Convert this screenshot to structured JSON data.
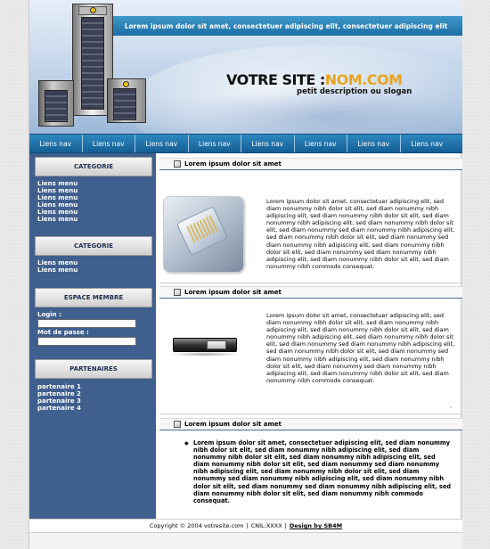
{
  "header": {
    "tagline": "Lorem ipsum dolor sit amet, consectetuer adipiscing elit, consectetuer adipiscing elit",
    "site_title_main": "VOTRE SITE :",
    "site_title_dom": "NOM.COM",
    "slogan": "petit description ou slogan"
  },
  "nav": {
    "items": [
      "Liens nav",
      "Liens nav",
      "Liens nav",
      "Liens nav",
      "Liens nav",
      "Liens nav",
      "Liens nav",
      "Liens nav"
    ]
  },
  "sidebar": {
    "category1_title": "CATEGORIE",
    "category1_links": [
      "Liens menu",
      "Liens menu",
      "Liens menu",
      "Liens menu",
      "Liens menu",
      "Liens menu"
    ],
    "category2_title": "CATEGORIE",
    "category2_links": [
      "Liens menu",
      "Liens menu"
    ],
    "member_title": "ESPACE MEMBRE",
    "login_label": "Login :",
    "password_label": "Mot de passe :",
    "login_value": "",
    "password_value": "",
    "partners_title": "PARTENAIRES",
    "partners": [
      "partenaire 1",
      "partenaire 2",
      "partenaire 3",
      "partenaire 4"
    ]
  },
  "main": {
    "sections": [
      {
        "title": "Lorem ipsum dolor sit amet",
        "text": "Lorem ipsum dolor sit amet, consectetuer adipiscing elit, sed diam nonummy nibh dolor sit elit, sed diam nonummy nibh adipiscing elit, sed diam nonummy nibh dolor sit elit, sed diam nonummy nibh adipiscing elit, sed diam nonummy nibh dolor sit elit, sed diam nonummy sed diam nonummy nibh adipiscing elit, sed diam nonummy nibh dolor sit elit, sed diam nonummy sed diam nonummy nibh adipiscing elit, sed diam nonummy nibh dolor sit elit, sed diam nonummy sed diam nonummy nibh adipiscing elit, sed diam nonummy nibh dolor sit elit, sed diam nonummy nibh commodo consequat."
      },
      {
        "title": "Lorem ipsum dolor sit amet",
        "text": "Lorem ipsum dolor sit amet, consectetuer adipiscing elit, sed diam nonummy nibh dolor sit elit, sed diam nonummy nibh adipiscing elit, sed diam nonummy nibh dolor sit elit, sed diam nonummy nibh adipiscing elit, sed diam nonummy nibh dolor sit elit, sed diam nonummy sed diam nonummy nibh adipiscing elit, sed diam nonummy nibh dolor sit elit, sed diam nonummy sed diam nonummy nibh adipiscing elit, sed diam nonummy nibh dolor sit elit, sed diam nonummy sed diam nonummy nibh adipiscing elit, sed diam nonummy nibh dolor sit elit, sed diam nonummy nibh commodo consequat.",
        "dot": "."
      },
      {
        "title": "Lorem ipsum dolor sit amet",
        "bullet": "Lorem ipsum dolor sit amet, consectetuer adipiscing elit, sed diam nonummy nibh dolor sit elit, sed diam nonummy nibh adipiscing elit, sed diam nonummy nibh dolor sit elit, sed diam nonummy nibh adipiscing elit, sed diam nonummy nibh dolor sit elit, sed diam nonummy sed diam nonummy nibh adipiscing elit, sed diam nonummy nibh dolor sit elit, sed diam nonummy sed diam nonummy nibh adipiscing elit, sed diam nonummy nibh dolor sit elit, sed diam nonummy sed diam nonummy nibh adipiscing elit, sed diam nonummy nibh dolor sit elit, sed diam nonummy nibh commodo consequat."
      }
    ]
  },
  "footer": {
    "copyright": "Copyright © 2004 votresite.com",
    "cnil": "CNIL:XXXX",
    "design": "Design by SB4M",
    "separator": "|"
  },
  "colors": {
    "nav_blue": "#1c6ea4",
    "sidebar_blue": "#3f5f8e",
    "logo_orange": "#e9a51e"
  }
}
